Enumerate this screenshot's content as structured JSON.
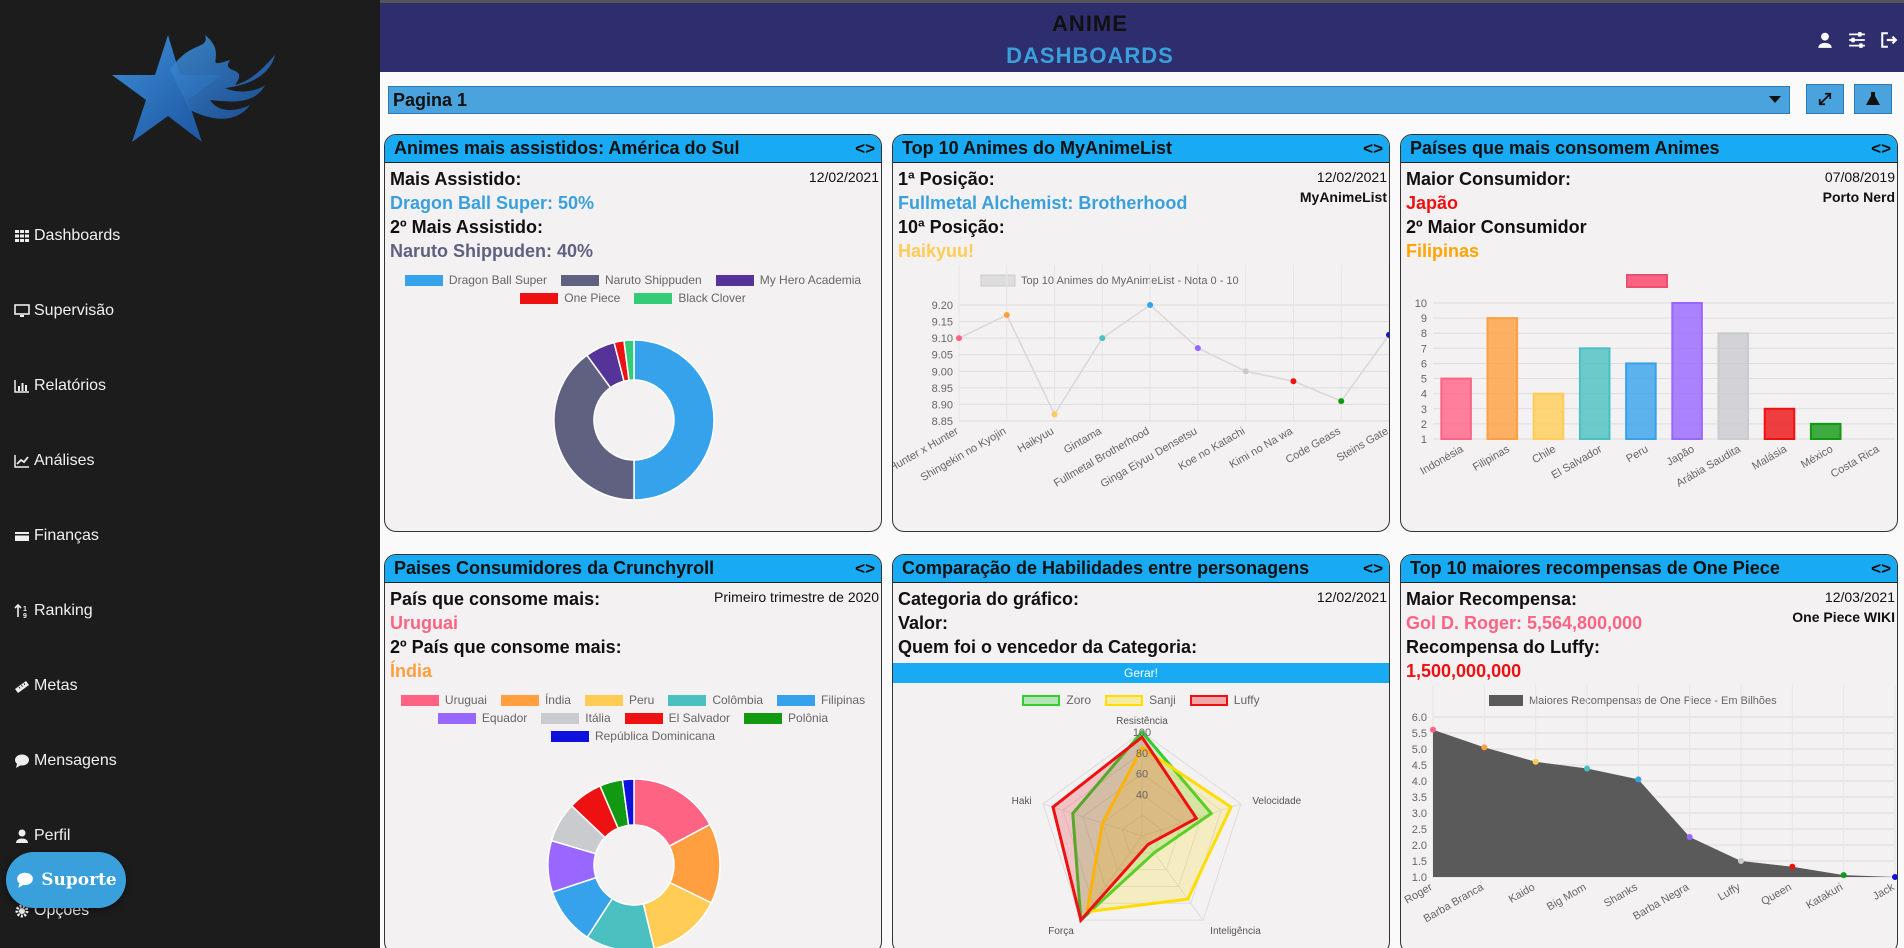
{
  "app": {
    "title_top": "ANIME",
    "title_bottom": "DASHBOARDS",
    "page_select": "Pagina 1",
    "support_label": "Suporte"
  },
  "colors": {
    "sidebar_bg": "#1c1c1c",
    "topbar_bg": "#2e2e6e",
    "accent_blue": "#18aaf2",
    "title_blue": "#3aa0dc",
    "card_bg": "#f3f1f2"
  },
  "sidebar": {
    "items": [
      {
        "label": "Dashboards",
        "icon": "grid-icon"
      },
      {
        "label": "Supervisão",
        "icon": "monitor-icon"
      },
      {
        "label": "Relatórios",
        "icon": "bar-chart-icon"
      },
      {
        "label": "Análises",
        "icon": "line-chart-icon"
      },
      {
        "label": "Finanças",
        "icon": "money-icon"
      },
      {
        "label": "Ranking",
        "icon": "sort-icon"
      },
      {
        "label": "Metas",
        "icon": "ruler-icon"
      },
      {
        "label": "Mensagens",
        "icon": "chat-icon"
      },
      {
        "label": "Perfil",
        "icon": "user-icon"
      },
      {
        "label": "Opções",
        "icon": "gear-icon"
      }
    ]
  },
  "cards": {
    "c1": {
      "title": "Animes mais assistidos: América do Sul",
      "date": "12/02/2021",
      "label1": "Mais Assistido:",
      "value1": "Dragon Ball Super: 50%",
      "label2": "2º Mais Assistido:",
      "value2": "Naruto Shippuden: 40%"
    },
    "c2": {
      "title": "Top 10 Animes do MyAnimeList",
      "date": "12/02/2021",
      "source": "MyAnimeList",
      "label1": "1ª Posição:",
      "value1": "Fullmetal Alchemist: Brotherhood",
      "label2": "10ª Posição:",
      "value2": "Haikyuu!"
    },
    "c3": {
      "title": "Países que mais consomem Animes",
      "date": "07/08/2019",
      "source": "Porto Nerd",
      "label1": "Maior Consumidor:",
      "value1": "Japão",
      "label2": "2º Maior Consumidor",
      "value2": "Filipinas"
    },
    "c4": {
      "title": "Paises Consumidores da Crunchyroll",
      "date": "Primeiro trimestre de 2020",
      "label1": "País que consome mais:",
      "value1": "Uruguai",
      "label2": "2º País que consome mais:",
      "value2": "Índia"
    },
    "c5": {
      "title": "Comparação de Habilidades entre personagens",
      "date": "12/02/2021",
      "label1": "Categoria do gráfico:",
      "label2": "Valor:",
      "label3": "Quem foi o vencedor da Categoria:",
      "button": "Gerar!"
    },
    "c6": {
      "title": "Top 10 maiores recompensas de One Piece",
      "date": "12/03/2021",
      "source": "One Piece WIKI",
      "label1": "Maior Recompensa:",
      "value1": "Gol D. Roger: 5,564,800,000",
      "label2": "Recompensa do Luffy:",
      "value2": "1,500,000,000"
    }
  },
  "chart_data": [
    {
      "type": "pie",
      "variant": "doughnut",
      "categories": [
        "Dragon Ball Super",
        "Naruto Shippuden",
        "My Hero Academia",
        "One Piece",
        "Black Clover"
      ],
      "values": [
        50,
        40,
        6,
        2,
        2
      ],
      "colors": [
        "#36a2eb",
        "#606080",
        "#553399",
        "#ee1111",
        "#33cc77"
      ],
      "legend": "top"
    },
    {
      "type": "line",
      "series_name": "Top 10 Animes do MyAnimeList - Nota 0 - 10",
      "categories": [
        "Hunter x Hunter",
        "Shingekin no Kyojin",
        "Haikyuu",
        "Gintama",
        "Fullmetal Brotherhood",
        "Ginga Eiyuu Densetsu",
        "Koe no Katachi",
        "Kimi no Na wa",
        "Code Geass",
        "Steins Gate"
      ],
      "values": [
        9.1,
        9.17,
        8.87,
        9.1,
        9.2,
        9.07,
        9.0,
        8.97,
        8.91,
        9.11
      ],
      "point_colors": [
        "#ff6384",
        "#ff9f40",
        "#ffcd56",
        "#4bc0c0",
        "#36a2eb",
        "#9966ff",
        "#c9cbcf",
        "#ee1111",
        "#119911",
        "#1111dd"
      ],
      "yticks": [
        "9.20",
        "9.15",
        "9.10",
        "9.05",
        "9.00",
        "8.95",
        "8.90",
        "8.85"
      ],
      "ylim": [
        8.85,
        9.2
      ],
      "legend": "top"
    },
    {
      "type": "bar",
      "categories": [
        "Indonésia",
        "Filipinas",
        "Chile",
        "El Salvador",
        "Peru",
        "Japão",
        "Arábia Saudita",
        "Malásia",
        "México",
        "Costa Rica"
      ],
      "values": [
        5,
        9,
        4,
        7,
        6,
        10,
        8,
        3,
        2,
        1
      ],
      "colors": [
        "#ff6384",
        "#ff9f40",
        "#ffcd56",
        "#4bc0c0",
        "#36a2eb",
        "#9966ff",
        "#c9cbcf",
        "#ee1111",
        "#119911",
        "#1111dd"
      ],
      "yticks": [
        "10",
        "9",
        "8",
        "7",
        "6",
        "5",
        "4",
        "3",
        "2",
        "1"
      ],
      "ylim": [
        1,
        10
      ],
      "legend": "top"
    },
    {
      "type": "pie",
      "variant": "doughnut",
      "categories": [
        "Uruguai",
        "Índia",
        "Peru",
        "Colômbia",
        "Filipinas",
        "Equador",
        "Itália",
        "El Salvador",
        "Polônia",
        "República Dominicana"
      ],
      "values": [
        16,
        14,
        13,
        12,
        10,
        9,
        7,
        6,
        4,
        2
      ],
      "colors": [
        "#ff6384",
        "#ff9f40",
        "#ffcd56",
        "#4bc0c0",
        "#36a2eb",
        "#9966ff",
        "#c9cbcf",
        "#ee1111",
        "#119911",
        "#1111dd"
      ],
      "legend": "top"
    },
    {
      "type": "radar",
      "axes": [
        "Resistência",
        "Velocidade",
        "Inteligência",
        "Força",
        "Haki"
      ],
      "ticks": [
        "100",
        "80",
        "60",
        "40"
      ],
      "series": [
        {
          "name": "Zoro",
          "values": [
            100,
            70,
            20,
            100,
            70
          ],
          "color": "#33cc33"
        },
        {
          "name": "Sanji",
          "values": [
            85,
            90,
            75,
            90,
            40
          ],
          "color": "#ffdd00"
        },
        {
          "name": "Luffy",
          "values": [
            95,
            55,
            10,
            100,
            90
          ],
          "color": "#ee1111"
        }
      ],
      "rmax": 100,
      "legend": "top"
    },
    {
      "type": "area",
      "series_name": "Maiores Recompensas de One Piece - Em Bilhões",
      "categories": [
        "Roger",
        "Barba Branca",
        "Kaido",
        "Big Mom",
        "Shanks",
        "Barba Negra",
        "Luffy",
        "Queen",
        "Katakuri",
        "Jack"
      ],
      "values": [
        5.6,
        5.05,
        4.6,
        4.39,
        4.05,
        2.25,
        1.5,
        1.32,
        1.06,
        1.0
      ],
      "point_colors": [
        "#ff6384",
        "#ff9f40",
        "#ffcd56",
        "#4bc0c0",
        "#36a2eb",
        "#9966ff",
        "#c9cbcf",
        "#ee1111",
        "#119911",
        "#1111dd"
      ],
      "yticks": [
        "6.0",
        "5.5",
        "5.0",
        "4.5",
        "4.0",
        "3.5",
        "3.0",
        "2.5",
        "2.0",
        "1.5",
        "1.0"
      ],
      "ylim": [
        1.0,
        6.0
      ],
      "legend": "top"
    }
  ]
}
